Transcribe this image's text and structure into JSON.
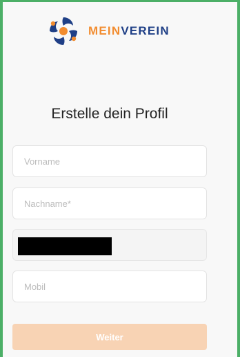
{
  "brand": {
    "name_part1": "MEIN",
    "name_part2": "VEREIN"
  },
  "title": "Erstelle dein Profil",
  "fields": {
    "first_name": {
      "placeholder": "Vorname",
      "value": ""
    },
    "last_name": {
      "placeholder": "Nachname*",
      "value": ""
    },
    "email": {
      "value": ""
    },
    "mobile": {
      "placeholder": "Mobil",
      "value": ""
    }
  },
  "submit_label": "Weiter",
  "colors": {
    "frame_green": "#4caf67",
    "brand_orange": "#f28c2f",
    "brand_navy": "#1f3f86",
    "button_disabled": "#f8d3b4"
  }
}
